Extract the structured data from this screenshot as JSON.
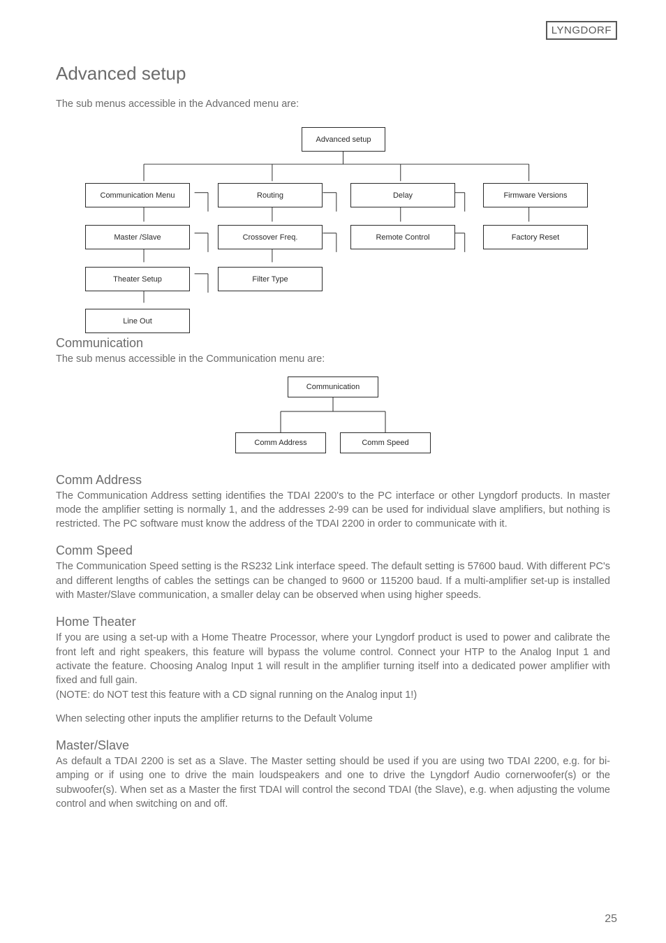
{
  "logo": {
    "part1": "LYNG",
    "part2": "DORF"
  },
  "title": "Advanced setup",
  "intro": "The sub menus accessible in the Advanced menu are:",
  "diagram1": {
    "root": "Advanced setup",
    "colA": [
      "Communication Menu",
      "Master /Slave",
      "Theater Setup",
      "Line Out"
    ],
    "colB": [
      "Routing",
      "Crossover Freq.",
      "Filter Type"
    ],
    "colC": [
      "Delay",
      "Remote Control"
    ],
    "colD": [
      "Firmware Versions",
      "Factory Reset"
    ]
  },
  "sections": {
    "communication": {
      "heading": "Communication",
      "text": "The sub menus accessible in the Communication menu are:"
    },
    "diagram2": {
      "root": "Communication",
      "left": "Comm Address",
      "right": "Comm Speed"
    },
    "commAddress": {
      "heading": "Comm Address",
      "text": "The Communication Address setting identifies the TDAI 2200's to the PC interface or other Lyngdorf products. In master mode the amplifier setting is normally 1, and the addresses 2-99 can be used for individual slave amplifiers, but nothing is restricted. The PC software must know the address of the TDAI 2200 in order to communicate with it."
    },
    "commSpeed": {
      "heading": "Comm Speed",
      "text": "The Communication Speed setting is the RS232 Link interface speed. The default setting is 57600 baud. With different PC's and different lengths of cables the settings can be changed to 9600 or 115200 baud. If a multi-amplifier set-up is installed with Master/Slave communication, a smaller delay can be observed when using higher speeds."
    },
    "homeTheater": {
      "heading": "Home Theater",
      "text1": "If you are using a set-up with a Home Theatre Processor, where your Lyngdorf product is used to power and calibrate the front left and right speakers, this feature will bypass the volume control. Connect your HTP to the Analog Input 1 and activate the feature. Choosing Analog Input 1 will result in the amplifier turning itself into a dedicated power amplifier with fixed and full gain.",
      "note": "(NOTE: do NOT test this feature with a CD signal running on the Analog input 1!)",
      "text2": "When selecting other inputs the amplifier returns to the Default Volume"
    },
    "masterSlave": {
      "heading": "Master/Slave",
      "text": "As default a TDAI 2200 is set as a Slave. The Master setting should be used if you are using two TDAI 2200, e.g. for bi-amping or if using one to drive the main loudspeakers and one to drive the Lyngdorf Audio cornerwoofer(s) or the subwoofer(s). When set as a Master the first TDAI will control the second TDAI (the Slave), e.g. when adjusting the volume control and when switching on and off."
    }
  },
  "pageNumber": "25"
}
